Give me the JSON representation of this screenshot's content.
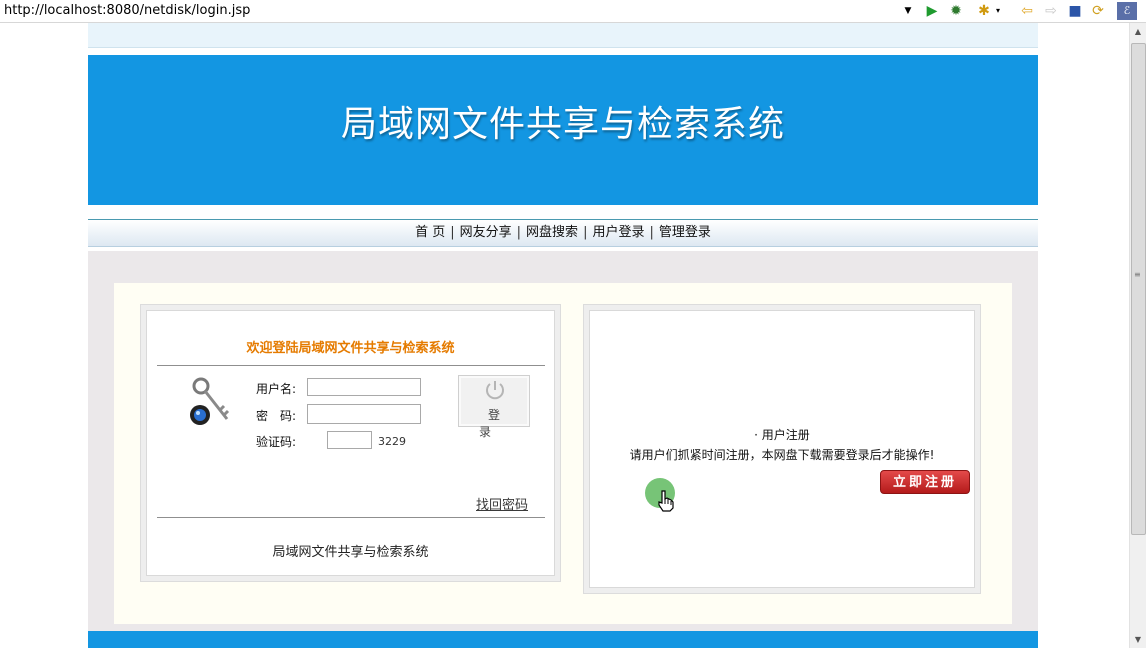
{
  "browser": {
    "url": "http://localhost:8080/netdisk/login.jsp",
    "toolbar_icons": [
      "run-icon",
      "debug-icon",
      "bookmark-add-icon",
      "back-icon",
      "forward-icon",
      "stop-icon",
      "refresh-icon",
      "browser-logo-icon"
    ]
  },
  "banner": {
    "title": "局域网文件共享与检索系统",
    "color": "#1396e2"
  },
  "nav": {
    "items": [
      {
        "label": "首 页"
      },
      {
        "label": "网友分享"
      },
      {
        "label": "网盘搜索"
      },
      {
        "label": "用户登录"
      },
      {
        "label": "管理登录"
      }
    ],
    "separator": "|"
  },
  "login": {
    "title": "欢迎登陆局域网文件共享与检索系统",
    "title_color": "#e57b00",
    "username_label": "用户名:",
    "username_value": "",
    "password_label": "密　码:",
    "password_value": "",
    "captcha_label": "验证码:",
    "captcha_value": "",
    "captcha_code": "3229",
    "login_button": "登录",
    "forgot_link": "找回密码",
    "footer": "局域网文件共享与检索系统"
  },
  "register": {
    "heading": "· 用户注册",
    "text": "请用户们抓紧时间注册，本网盘下载需要登录后才能操作!",
    "button": "立即注册",
    "button_color": "#c82424"
  }
}
